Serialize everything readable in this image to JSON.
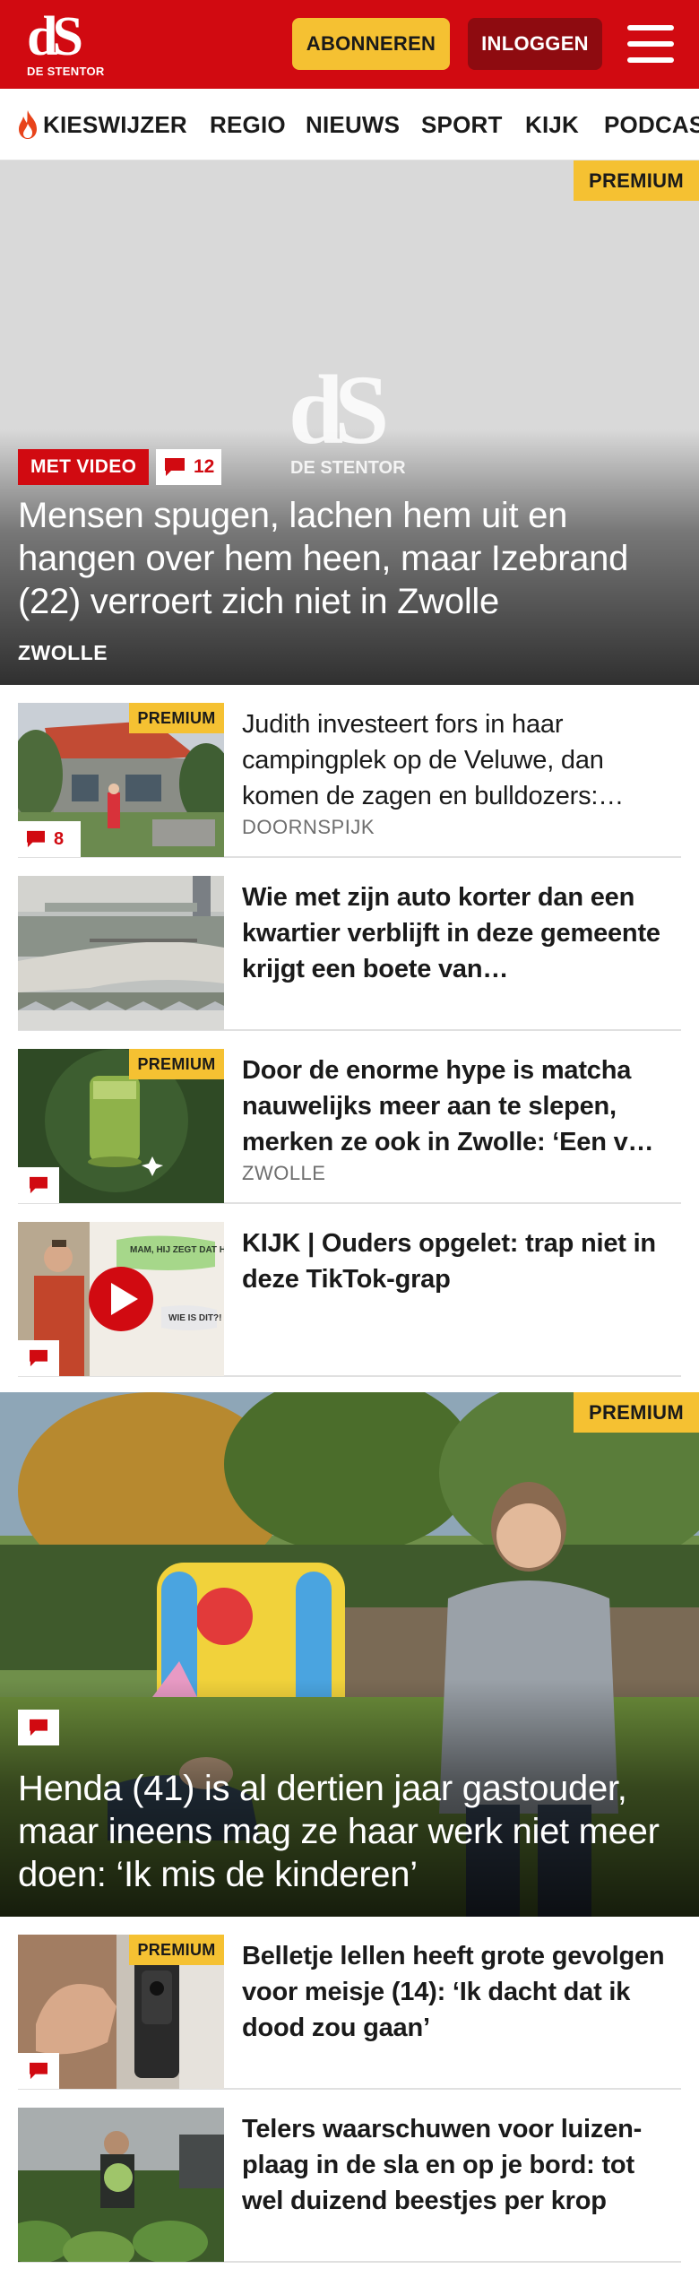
{
  "header": {
    "logo_mark": "dS",
    "logo_text": "DE STENTOR",
    "subscribe_label": "ABONNEREN",
    "login_label": "INLOGGEN",
    "menu_icon": "hamburger-icon",
    "brand_color": "#d10a11",
    "accent_color": "#f5c132"
  },
  "nav": {
    "items": [
      "KIESWIJZER",
      "REGIO",
      "NIEUWS",
      "SPORT",
      "KIJK",
      "PODCAST"
    ],
    "kieswijzer_icon": "flame-icon"
  },
  "hero": {
    "premium": "PREMIUM",
    "video_label": "MET VIDEO",
    "comments": "12",
    "watermark_mark": "dS",
    "watermark_text": "DE STENTOR",
    "title": "Mensen spugen, lachen hem uit en hangen over hem heen, maar Izebrand (22) verroert zich niet in Zwolle",
    "location": "ZWOLLE"
  },
  "articles": [
    {
      "premium": "PREMIUM",
      "comments": "8",
      "title": "Judith investeert fors in haar campingplek op de Veluwe, dan komen de zagen en bulldozers:…",
      "location": "DOORNSPIJK"
    },
    {
      "title": "Wie met zijn auto korter dan een kwartier verblijft in deze gemeente krijgt een boete van…"
    },
    {
      "premium": "PREMIUM",
      "title": "Door de enorme hype is matcha nauwelijks meer aan te slepen, merken ze ook in Zwolle: ‘Een v…",
      "location": "ZWOLLE"
    },
    {
      "title": "KIJK | Ouders opgelet: trap niet in deze TikTok-grap",
      "thumb_bubble_1": "MAM, HIJ ZEGT DAT HIJ JE KENT?",
      "thumb_bubble_2": "WIE IS DIT?!"
    },
    {
      "premium": "PREMIUM",
      "title": "Belletje lellen heeft grote gevolgen voor meisje (14): ‘Ik dacht dat ik dood zou gaan’"
    },
    {
      "title": "Telers waarschuwen voor luizen-plaag in de sla en op je bord: tot wel duizend beestjes per krop"
    }
  ],
  "feature": {
    "premium": "PREMIUM",
    "title": "Henda (41) is al dertien jaar gastouder, maar ineens mag ze haar werk niet meer doen: ‘Ik mis de kinderen’"
  }
}
